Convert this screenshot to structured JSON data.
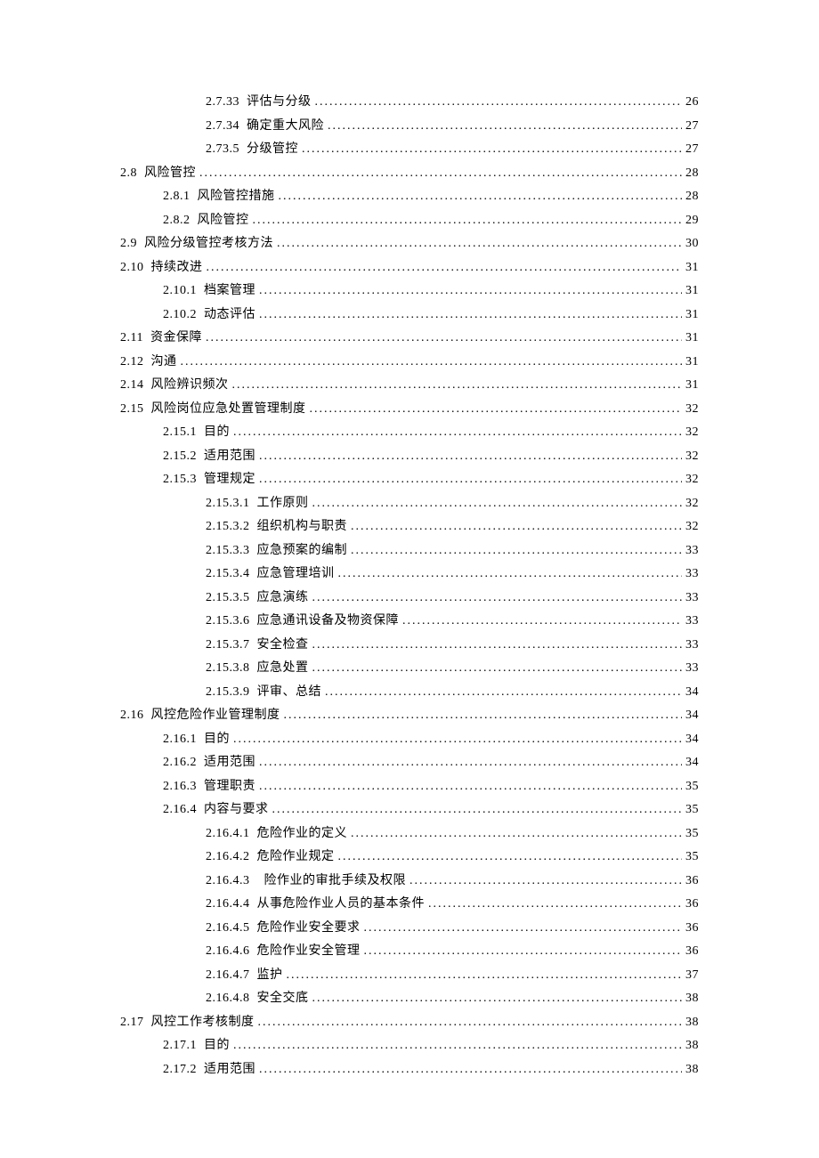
{
  "toc": [
    {
      "num": "2.7.33",
      "title": "评估与分级",
      "page": "26",
      "lvl": 2
    },
    {
      "num": "2.7.34",
      "title": "确定重大风险",
      "page": "27",
      "lvl": 2
    },
    {
      "num": "2.73.5",
      "title": "分级管控",
      "page": "27",
      "lvl": 2
    },
    {
      "num": "2.8",
      "title": "风险管控",
      "page": "28",
      "lvl": 0
    },
    {
      "num": "2.8.1",
      "title": "风险管控措施",
      "page": "28",
      "lvl": 1
    },
    {
      "num": "2.8.2",
      "title": "风险管控",
      "page": "29",
      "lvl": 1
    },
    {
      "num": "2.9",
      "title": "风险分级管控考核方法",
      "page": "30",
      "lvl": 0
    },
    {
      "num": "2.10",
      "title": "持续改进",
      "page": "31",
      "lvl": 0
    },
    {
      "num": "2.10.1",
      "title": "档案管理",
      "page": "31",
      "lvl": 1
    },
    {
      "num": "2.10.2",
      "title": "动态评估",
      "page": "31",
      "lvl": 1
    },
    {
      "num": "2.11",
      "title": "资金保障",
      "page": "31",
      "lvl": 0
    },
    {
      "num": "2.12",
      "title": "沟通",
      "page": "31",
      "lvl": 0
    },
    {
      "num": "2.14",
      "title": "风险辨识频次",
      "page": "31",
      "lvl": 0
    },
    {
      "num": "2.15",
      "title": "风险岗位应急处置管理制度",
      "page": "32",
      "lvl": 0
    },
    {
      "num": "2.15.1",
      "title": "目的",
      "page": "32",
      "lvl": 1
    },
    {
      "num": "2.15.2",
      "title": "适用范围",
      "page": "32",
      "lvl": 1
    },
    {
      "num": "2.15.3",
      "title": "管理规定",
      "page": "32",
      "lvl": 1
    },
    {
      "num": "2.15.3.1",
      "title": "工作原则",
      "page": "32",
      "lvl": 2
    },
    {
      "num": "2.15.3.2",
      "title": "组织机构与职责",
      "page": "32",
      "lvl": 2
    },
    {
      "num": "2.15.3.3",
      "title": "应急预案的编制",
      "page": "33",
      "lvl": 2
    },
    {
      "num": "2.15.3.4",
      "title": "应急管理培训",
      "page": "33",
      "lvl": 2
    },
    {
      "num": "2.15.3.5",
      "title": "应急演练",
      "page": "33",
      "lvl": 2
    },
    {
      "num": "2.15.3.6",
      "title": "应急通讯设备及物资保障",
      "page": "33",
      "lvl": 2
    },
    {
      "num": "2.15.3.7",
      "title": "安全检查",
      "page": "33",
      "lvl": 2
    },
    {
      "num": "2.15.3.8",
      "title": "应急处置",
      "page": "33",
      "lvl": 2
    },
    {
      "num": "2.15.3.9",
      "title": "评审、总结",
      "page": "34",
      "lvl": 2
    },
    {
      "num": "2.16",
      "title": "风控危险作业管理制度",
      "page": "34",
      "lvl": 0
    },
    {
      "num": "2.16.1",
      "title": "目的",
      "page": "34",
      "lvl": 1
    },
    {
      "num": "2.16.2",
      "title": "适用范围",
      "page": "34",
      "lvl": 1
    },
    {
      "num": "2.16.3",
      "title": "管理职责",
      "page": "35",
      "lvl": 1
    },
    {
      "num": "2.16.4",
      "title": "内容与要求",
      "page": "35",
      "lvl": 1
    },
    {
      "num": "2.16.4.1",
      "title": "危险作业的定义",
      "page": "35",
      "lvl": 2
    },
    {
      "num": "2.16.4.2",
      "title": "危险作业规定",
      "page": "35",
      "lvl": 2
    },
    {
      "num": "2.16.4.3",
      "title": "  险作业的审批手续及权限",
      "page": "36",
      "lvl": 2
    },
    {
      "num": "2.16.4.4",
      "title": "从事危险作业人员的基本条件",
      "page": "36",
      "lvl": 2
    },
    {
      "num": "2.16.4.5",
      "title": "危险作业安全要求",
      "page": "36",
      "lvl": 2
    },
    {
      "num": "2.16.4.6",
      "title": "危险作业安全管理",
      "page": "36",
      "lvl": 2
    },
    {
      "num": "2.16.4.7",
      "title": "监护",
      "page": "37",
      "lvl": 2
    },
    {
      "num": "2.16.4.8",
      "title": "安全交底",
      "page": "38",
      "lvl": 2
    },
    {
      "num": "2.17",
      "title": "风控工作考核制度",
      "page": "38",
      "lvl": 0
    },
    {
      "num": "2.17.1",
      "title": "目的",
      "page": "38",
      "lvl": 1
    },
    {
      "num": "2.17.2",
      "title": "适用范围",
      "page": "38",
      "lvl": 1
    }
  ]
}
